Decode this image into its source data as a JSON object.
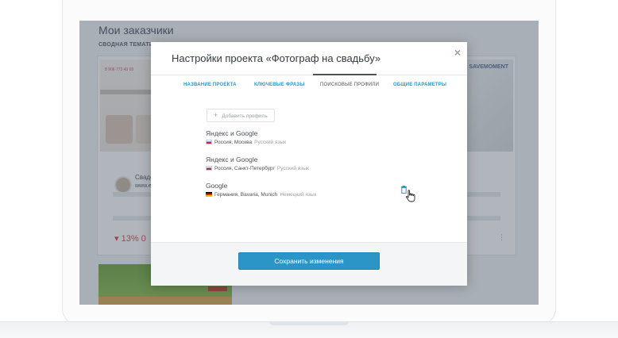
{
  "background_page": {
    "title": "Мои заказчики",
    "section_label": "СВОДНАЯ ТЕМАТИК",
    "card1": {
      "phone": "8 906 773 43 03",
      "name_partial": "Сваде",
      "url_partial": "www.e",
      "percent": "13% 0"
    },
    "card2": {
      "logo": "SAVEMOMENT"
    }
  },
  "modal": {
    "title": "Настройки проекта «Фотограф на свадьбу»",
    "close_label": "×",
    "tabs": [
      {
        "label": "НАЗВАНИЕ ПРОЕКТА",
        "active": false
      },
      {
        "label": "КЛЮЧЕВЫЕ ФРАЗЫ",
        "active": false
      },
      {
        "label": "ПОИСКОВЫЕ ПРОФИЛИ",
        "active": true
      },
      {
        "label": "ОБЩИЕ ПАРАМЕТРЫ",
        "active": false
      }
    ],
    "add_profile_label": "Добавить профиль",
    "profiles": [
      {
        "engine": "Яндекс и Google",
        "flag": "flag-russia-icon",
        "region": "Россия, Москва",
        "language": "Русский язык"
      },
      {
        "engine": "Яндекс и Google",
        "flag": "flag-russia-icon",
        "region": "Россия, Санкт-Петербург",
        "language": "Русский язык"
      },
      {
        "engine": "Google",
        "flag": "flag-germany-icon",
        "region": "Германия, Bavaria, Munich",
        "language": "Немецкий язык"
      }
    ],
    "save_label": "Сохранить изменения"
  },
  "colors": {
    "accent": "#2a95c6",
    "overlay": "rgba(70,80,95,0.42)",
    "muted_text": "#9aa0a6",
    "danger": "#d04848"
  }
}
